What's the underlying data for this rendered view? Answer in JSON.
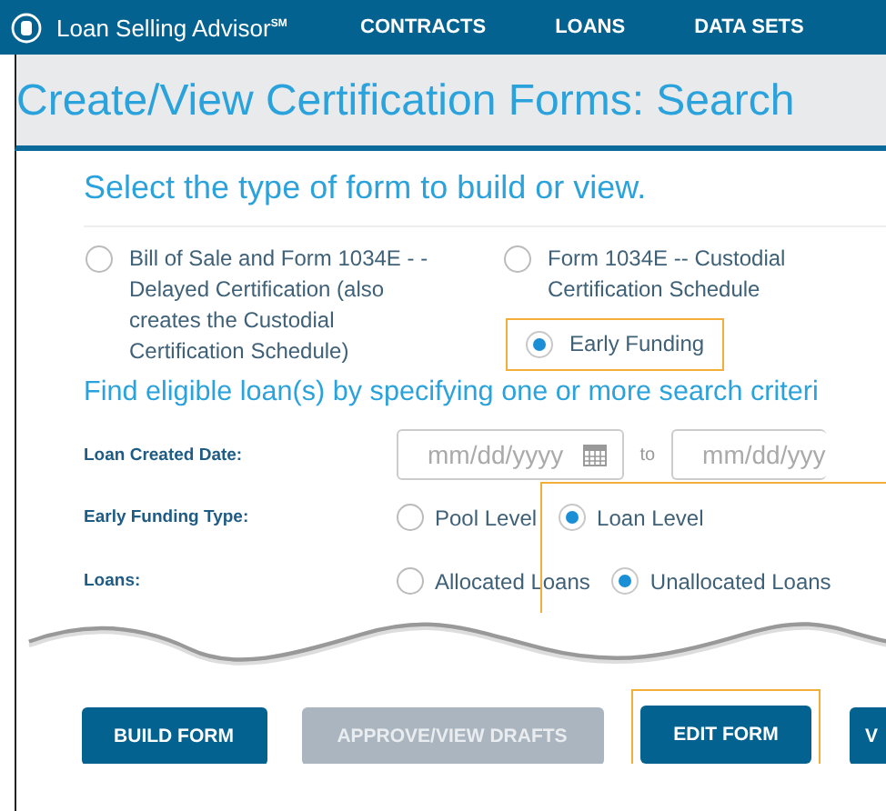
{
  "header": {
    "logo_text": "Loan Selling Advisor",
    "logo_mark": "SM",
    "nav": [
      {
        "label": "CONTRACTS"
      },
      {
        "label": "LOANS"
      },
      {
        "label": "DATA SETS"
      }
    ]
  },
  "page_title": "Create/View Certification Forms: Search",
  "form_type": {
    "heading": "Select the type of form to build or view.",
    "options": [
      {
        "label": "Bill of Sale and Form 1034E - - Delayed Certification (also creates the Custodial Certification Schedule)",
        "selected": false,
        "highlighted": false
      },
      {
        "label": "Form 1034E -- Custodial Certification Schedule",
        "selected": false,
        "highlighted": false
      },
      {
        "label": "Early Funding",
        "selected": true,
        "highlighted": true
      }
    ]
  },
  "criteria": {
    "heading": "Find eligible loan(s) by specifying one or more search criteri",
    "rows": [
      {
        "kind": "date-range",
        "label": "Loan Created Date:",
        "from_placeholder": "mm/dd/yyyy",
        "separator": "to",
        "to_placeholder": "mm/dd/yyy"
      },
      {
        "kind": "radio-group",
        "label": "Early Funding Type:",
        "options": [
          {
            "label": "Pool Level",
            "selected": false,
            "highlighted": false
          },
          {
            "label": "Loan Level",
            "selected": true,
            "highlighted": true
          }
        ]
      },
      {
        "kind": "radio-group",
        "label": "Loans:",
        "options": [
          {
            "label": "Allocated Loans",
            "selected": false,
            "highlighted": false
          },
          {
            "label": "Unallocated Loans",
            "selected": true,
            "highlighted": true
          }
        ]
      }
    ]
  },
  "buttons": [
    {
      "label": "BUILD FORM",
      "disabled": false,
      "highlighted": false
    },
    {
      "label": "APPROVE/VIEW DRAFTS",
      "disabled": true,
      "highlighted": false
    },
    {
      "label": "EDIT FORM",
      "disabled": false,
      "highlighted": true
    },
    {
      "label": "V",
      "disabled": false,
      "highlighted": false
    }
  ]
}
